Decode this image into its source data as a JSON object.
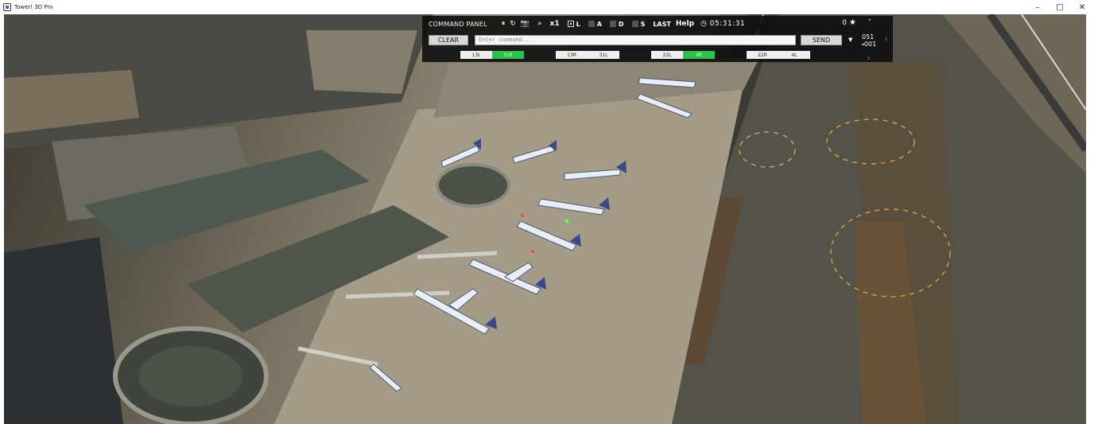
{
  "window": {
    "title": "Tower! 3D Pro",
    "minimize": "–",
    "maximize": "□",
    "close": "✕"
  },
  "command_panel": {
    "title": "COMMAND PANEL",
    "pause_icon": "⏸",
    "restart_icon": "↻",
    "camera_icon": "📷",
    "fast_forward_icon": "»",
    "speed": "x1",
    "toggles": [
      {
        "label": "L",
        "checked": true
      },
      {
        "label": "A",
        "checked": false
      },
      {
        "label": "D",
        "checked": false
      },
      {
        "label": "S",
        "checked": false
      }
    ],
    "last_label": "LAST",
    "help_label": "Help",
    "clock": "05:31:31",
    "score": "0",
    "clear_label": "CLEAR",
    "input_placeholder": "Enter command...",
    "send_label": "SEND",
    "runways": [
      {
        "label": "13L",
        "active": false
      },
      {
        "label": "31R",
        "active": true
      },
      {
        "label": "13R",
        "active": false
      },
      {
        "label": "31L",
        "active": false
      },
      {
        "label": "22L",
        "active": false
      },
      {
        "label": "4R",
        "active": true
      },
      {
        "label": "22R",
        "active": false
      },
      {
        "label": "4L",
        "active": false
      }
    ]
  },
  "compass": {
    "heading": "051",
    "wind": "001",
    "marker_arrow": "⬩"
  },
  "colors": {
    "panel_bg": "#0c0c0c",
    "runway_active": "#2fbf4f",
    "runway_inactive": "#efefef"
  }
}
